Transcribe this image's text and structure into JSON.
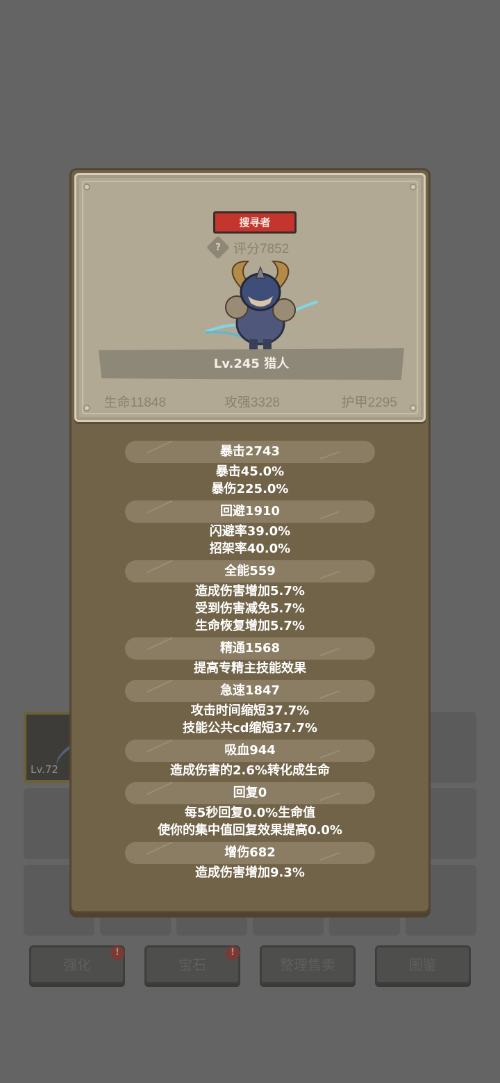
{
  "background": {
    "equipped_slot_level": "Lv.72",
    "buttons": [
      {
        "label": "强化",
        "badge": "!"
      },
      {
        "label": "宝石",
        "badge": "!"
      },
      {
        "label": "整理售卖",
        "badge": ""
      },
      {
        "label": "图鉴",
        "badge": ""
      }
    ]
  },
  "hero": {
    "class_name": "搜寻者",
    "score_icon": "?",
    "score": "评分7852",
    "avatar_icon": "hunter-avatar-icon",
    "name": "Lv.245 猎人",
    "hp": "生命11848",
    "attack": "攻强3328",
    "armor": "护甲2295"
  },
  "stats": [
    {
      "title": "暴击2743",
      "lines": [
        "暴击45.0%",
        "暴伤225.0%"
      ]
    },
    {
      "title": "回避1910",
      "lines": [
        "闪避率39.0%",
        "招架率40.0%"
      ]
    },
    {
      "title": "全能559",
      "lines": [
        "造成伤害增加5.7%",
        "受到伤害减免5.7%",
        "生命恢复增加5.7%"
      ]
    },
    {
      "title": "精通1568",
      "lines": [
        "提高专精主技能效果"
      ]
    },
    {
      "title": "急速1847",
      "lines": [
        "攻击时间缩短37.7%",
        "技能公共cd缩短37.7%"
      ]
    },
    {
      "title": "吸血944",
      "lines": [
        "造成伤害的2.6%转化成生命"
      ]
    },
    {
      "title": "回复0",
      "lines": [
        "每5秒回复0.0%生命值",
        "使你的集中值回复效果提高0.0%"
      ]
    },
    {
      "title": "增伤682",
      "lines": [
        "造成伤害增加9.3%"
      ]
    }
  ],
  "colors": {
    "overlay": "#646464",
    "panel": "#716348",
    "card": "#b2a995",
    "class_tag": "#c4352d",
    "stat_header": "#8a7d63"
  }
}
